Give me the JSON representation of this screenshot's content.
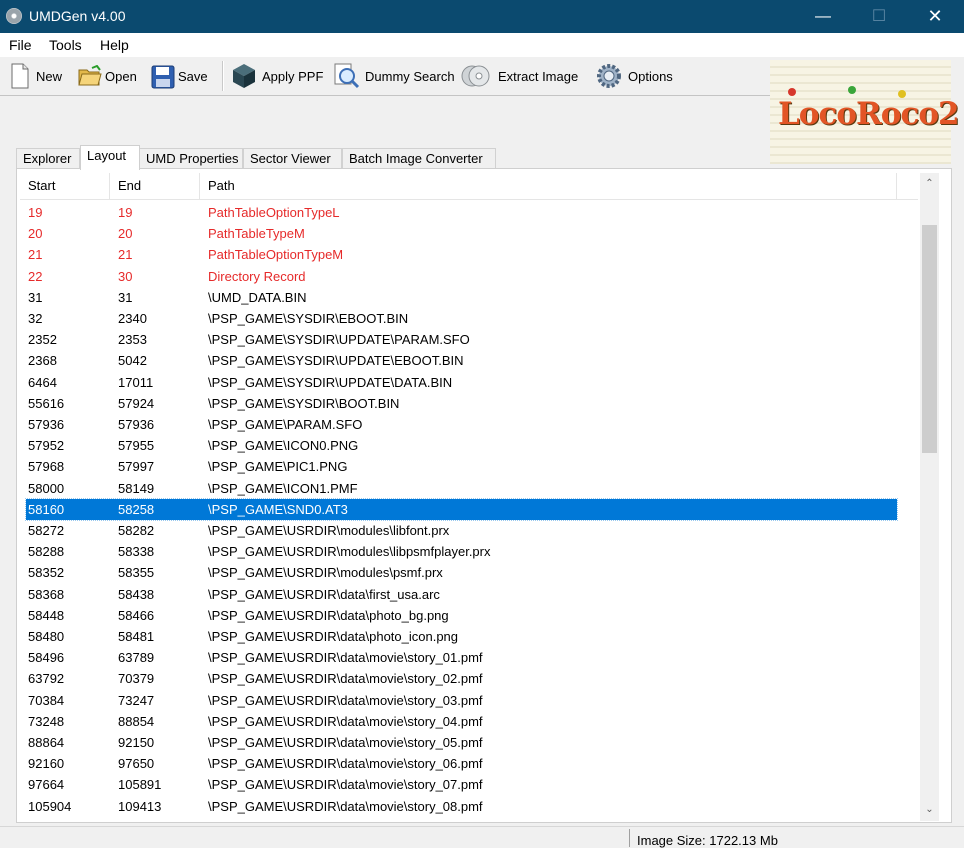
{
  "window": {
    "title": "UMDGen v4.00",
    "minimize": "—",
    "maximize": "☐",
    "close": "✕"
  },
  "menu": [
    "File",
    "Tools",
    "Help"
  ],
  "toolbar": [
    {
      "label": "New",
      "icon": "new-file-icon"
    },
    {
      "label": "Open",
      "icon": "open-folder-icon"
    },
    {
      "label": "Save",
      "icon": "save-disk-icon"
    },
    {
      "label": "Apply PPF",
      "icon": "apply-ppf-cube-icon"
    },
    {
      "label": "Dummy Search",
      "icon": "magnifier-search-icon"
    },
    {
      "label": "Extract Image",
      "icon": "disc-extract-icon"
    },
    {
      "label": "Options",
      "icon": "gear-icon"
    }
  ],
  "logo": {
    "text": "LocoRoco2"
  },
  "tabs": [
    "Explorer",
    "Layout",
    "UMD Properties",
    "Sector Viewer",
    "Batch Image Converter"
  ],
  "active_tab": "Layout",
  "table": {
    "columns": [
      "Start",
      "End",
      "Path"
    ],
    "rows": [
      {
        "start": "19",
        "end": "19",
        "path": "PathTableOptionTypeL",
        "style": "red"
      },
      {
        "start": "20",
        "end": "20",
        "path": "PathTableTypeM",
        "style": "red"
      },
      {
        "start": "21",
        "end": "21",
        "path": "PathTableOptionTypeM",
        "style": "red"
      },
      {
        "start": "22",
        "end": "30",
        "path": "Directory Record",
        "style": "red"
      },
      {
        "start": "31",
        "end": "31",
        "path": "\\UMD_DATA.BIN",
        "style": "normal"
      },
      {
        "start": "32",
        "end": "2340",
        "path": "\\PSP_GAME\\SYSDIR\\EBOOT.BIN",
        "style": "normal"
      },
      {
        "start": "2352",
        "end": "2353",
        "path": "\\PSP_GAME\\SYSDIR\\UPDATE\\PARAM.SFO",
        "style": "normal"
      },
      {
        "start": "2368",
        "end": "5042",
        "path": "\\PSP_GAME\\SYSDIR\\UPDATE\\EBOOT.BIN",
        "style": "normal"
      },
      {
        "start": "6464",
        "end": "17011",
        "path": "\\PSP_GAME\\SYSDIR\\UPDATE\\DATA.BIN",
        "style": "normal"
      },
      {
        "start": "55616",
        "end": "57924",
        "path": "\\PSP_GAME\\SYSDIR\\BOOT.BIN",
        "style": "normal"
      },
      {
        "start": "57936",
        "end": "57936",
        "path": "\\PSP_GAME\\PARAM.SFO",
        "style": "normal"
      },
      {
        "start": "57952",
        "end": "57955",
        "path": "\\PSP_GAME\\ICON0.PNG",
        "style": "normal"
      },
      {
        "start": "57968",
        "end": "57997",
        "path": "\\PSP_GAME\\PIC1.PNG",
        "style": "normal"
      },
      {
        "start": "58000",
        "end": "58149",
        "path": "\\PSP_GAME\\ICON1.PMF",
        "style": "normal"
      },
      {
        "start": "58160",
        "end": "58258",
        "path": "\\PSP_GAME\\SND0.AT3",
        "style": "selected"
      },
      {
        "start": "58272",
        "end": "58282",
        "path": "\\PSP_GAME\\USRDIR\\modules\\libfont.prx",
        "style": "normal"
      },
      {
        "start": "58288",
        "end": "58338",
        "path": "\\PSP_GAME\\USRDIR\\modules\\libpsmfplayer.prx",
        "style": "normal"
      },
      {
        "start": "58352",
        "end": "58355",
        "path": "\\PSP_GAME\\USRDIR\\modules\\psmf.prx",
        "style": "normal"
      },
      {
        "start": "58368",
        "end": "58438",
        "path": "\\PSP_GAME\\USRDIR\\data\\first_usa.arc",
        "style": "normal"
      },
      {
        "start": "58448",
        "end": "58466",
        "path": "\\PSP_GAME\\USRDIR\\data\\photo_bg.png",
        "style": "normal"
      },
      {
        "start": "58480",
        "end": "58481",
        "path": "\\PSP_GAME\\USRDIR\\data\\photo_icon.png",
        "style": "normal"
      },
      {
        "start": "58496",
        "end": "63789",
        "path": "\\PSP_GAME\\USRDIR\\data\\movie\\story_01.pmf",
        "style": "normal"
      },
      {
        "start": "63792",
        "end": "70379",
        "path": "\\PSP_GAME\\USRDIR\\data\\movie\\story_02.pmf",
        "style": "normal"
      },
      {
        "start": "70384",
        "end": "73247",
        "path": "\\PSP_GAME\\USRDIR\\data\\movie\\story_03.pmf",
        "style": "normal"
      },
      {
        "start": "73248",
        "end": "88854",
        "path": "\\PSP_GAME\\USRDIR\\data\\movie\\story_04.pmf",
        "style": "normal"
      },
      {
        "start": "88864",
        "end": "92150",
        "path": "\\PSP_GAME\\USRDIR\\data\\movie\\story_05.pmf",
        "style": "normal"
      },
      {
        "start": "92160",
        "end": "97650",
        "path": "\\PSP_GAME\\USRDIR\\data\\movie\\story_06.pmf",
        "style": "normal"
      },
      {
        "start": "97664",
        "end": "105891",
        "path": "\\PSP_GAME\\USRDIR\\data\\movie\\story_07.pmf",
        "style": "normal"
      },
      {
        "start": "105904",
        "end": "109413",
        "path": "\\PSP_GAME\\USRDIR\\data\\movie\\story_08.pmf",
        "style": "normal"
      }
    ]
  },
  "scrollbar": {
    "up": "⌃",
    "down": "⌄"
  },
  "status": {
    "text": "Image Size: 1722.13 Mb"
  },
  "colors": {
    "titlebar": "#0b4a6f",
    "selection": "#0078d7",
    "system_entry": "#e62a2a"
  }
}
